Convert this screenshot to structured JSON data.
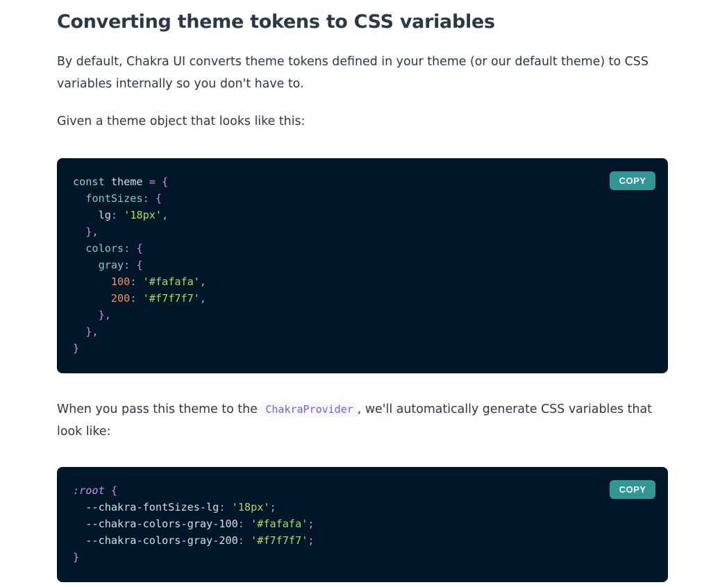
{
  "heading": "Converting theme tokens to CSS variables",
  "para1": "By default, Chakra UI converts theme tokens defined in your theme (or our default theme) to CSS variables internally so you don't have to.",
  "para2": "Given a theme object that looks like this:",
  "para3": {
    "before": "When you pass this theme to the ",
    "code": "ChakraProvider",
    "after": ", we'll automatically generate CSS variables that look like:"
  },
  "code1": {
    "copy_label": "COPY",
    "lines": [
      [
        [
          "kw2",
          "const"
        ],
        [
          "plain",
          " theme "
        ],
        [
          "punc",
          "="
        ],
        [
          "punc",
          " {"
        ]
      ],
      [
        [
          "plain",
          "  "
        ],
        [
          "prop",
          "fontSizes"
        ],
        [
          "punc",
          ":"
        ],
        [
          "punc",
          " {"
        ]
      ],
      [
        [
          "plain",
          "    "
        ],
        [
          "plain",
          "lg"
        ],
        [
          "punc",
          ":"
        ],
        [
          "plain",
          " "
        ],
        [
          "str",
          "'18px'"
        ],
        [
          "punc",
          ","
        ]
      ],
      [
        [
          "plain",
          "  "
        ],
        [
          "punc",
          "},"
        ]
      ],
      [
        [
          "plain",
          "  "
        ],
        [
          "prop",
          "colors"
        ],
        [
          "punc",
          ":"
        ],
        [
          "punc",
          " {"
        ]
      ],
      [
        [
          "plain",
          "    "
        ],
        [
          "prop",
          "gray"
        ],
        [
          "punc",
          ":"
        ],
        [
          "punc",
          " {"
        ]
      ],
      [
        [
          "plain",
          "      "
        ],
        [
          "num",
          "100"
        ],
        [
          "punc",
          ":"
        ],
        [
          "plain",
          " "
        ],
        [
          "str",
          "'#fafafa'"
        ],
        [
          "punc",
          ","
        ]
      ],
      [
        [
          "plain",
          "      "
        ],
        [
          "num",
          "200"
        ],
        [
          "punc",
          ":"
        ],
        [
          "plain",
          " "
        ],
        [
          "str",
          "'#f7f7f7'"
        ],
        [
          "punc",
          ","
        ]
      ],
      [
        [
          "plain",
          "    "
        ],
        [
          "punc",
          "},"
        ]
      ],
      [
        [
          "plain",
          "  "
        ],
        [
          "punc",
          "},"
        ]
      ],
      [
        [
          "punc",
          "}"
        ]
      ]
    ]
  },
  "code2": {
    "copy_label": "COPY",
    "lines": [
      [
        [
          "sel",
          ":root"
        ],
        [
          "punc",
          " {"
        ]
      ],
      [
        [
          "plain",
          "  "
        ],
        [
          "var",
          "--chakra-fontSizes-lg"
        ],
        [
          "punc",
          ":"
        ],
        [
          "plain",
          " "
        ],
        [
          "str",
          "'18px'"
        ],
        [
          "punc",
          ";"
        ]
      ],
      [
        [
          "plain",
          "  "
        ],
        [
          "var",
          "--chakra-colors-gray-100"
        ],
        [
          "punc",
          ":"
        ],
        [
          "plain",
          " "
        ],
        [
          "str",
          "'#fafafa'"
        ],
        [
          "punc",
          ";"
        ]
      ],
      [
        [
          "plain",
          "  "
        ],
        [
          "var",
          "--chakra-colors-gray-200"
        ],
        [
          "punc",
          ":"
        ],
        [
          "plain",
          " "
        ],
        [
          "str",
          "'#f7f7f7'"
        ],
        [
          "punc",
          ";"
        ]
      ],
      [
        [
          "punc",
          "}"
        ]
      ]
    ]
  }
}
